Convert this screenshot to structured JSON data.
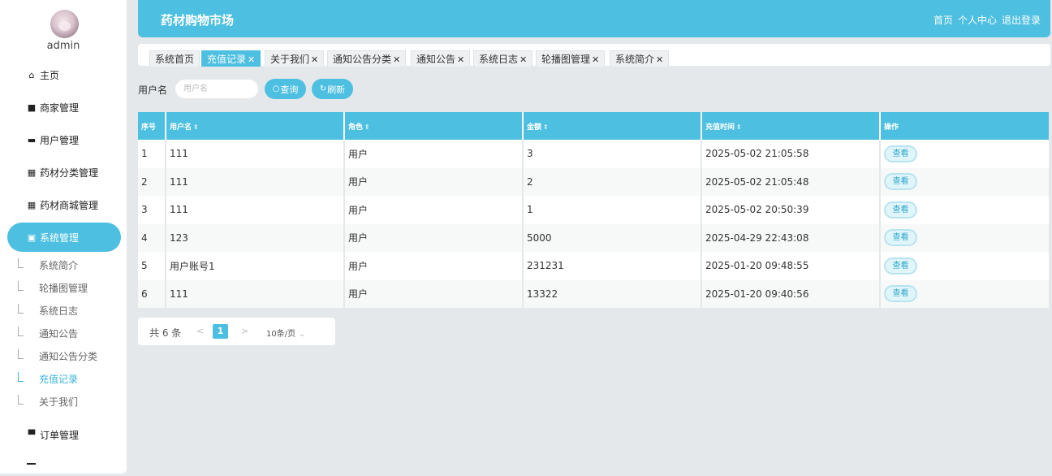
{
  "user": {
    "name": "admin"
  },
  "sidebar": {
    "items": [
      {
        "label": "主页",
        "icon": "home-icon"
      },
      {
        "label": "商家管理",
        "icon": "briefcase-icon"
      },
      {
        "label": "用户管理",
        "icon": "chat-icon"
      },
      {
        "label": "药材分类管理",
        "icon": "grid-icon"
      },
      {
        "label": "药材商城管理",
        "icon": "grid-icon"
      },
      {
        "label": "系统管理",
        "icon": "clipboard-icon"
      },
      {
        "label": "订单管理",
        "icon": "monitor-icon"
      }
    ],
    "sub_items": [
      "系统简介",
      "轮播图管理",
      "系统日志",
      "通知公告",
      "通知公告分类",
      "充值记录",
      "关于我们"
    ]
  },
  "header": {
    "title": "药材购物市场",
    "links": [
      "首页",
      "个人中心",
      "退出登录"
    ]
  },
  "tabs": [
    "系统首页",
    "充值记录",
    "关于我们",
    "通知公告分类",
    "通知公告",
    "系统日志",
    "轮播图管理",
    "系统简介"
  ],
  "search": {
    "label": "用户名",
    "placeholder": "用户名",
    "query_label": "查询",
    "refresh_label": "刷新"
  },
  "table": {
    "columns": [
      "序号",
      "用户名",
      "角色",
      "金额",
      "充值时间",
      "操作"
    ],
    "rows": [
      [
        "1",
        "111",
        "用户",
        "3",
        "2025-05-02 21:05:58"
      ],
      [
        "2",
        "111",
        "用户",
        "2",
        "2025-05-02 21:05:48"
      ],
      [
        "3",
        "111",
        "用户",
        "1",
        "2025-05-02 20:50:39"
      ],
      [
        "4",
        "123",
        "用户",
        "5000",
        "2025-04-29 22:43:08"
      ],
      [
        "5",
        "用户账号1",
        "用户",
        "231231",
        "2025-01-20 09:48:55"
      ],
      [
        "6",
        "111",
        "用户",
        "13322",
        "2025-01-20 09:40:56"
      ]
    ],
    "action_label": "查看"
  },
  "pagination": {
    "total": "共 6 条",
    "current_page": "1",
    "page_size": "10条/页"
  },
  "colors": {
    "accent": "#4dbfe0",
    "background": "#e4e8ea"
  }
}
